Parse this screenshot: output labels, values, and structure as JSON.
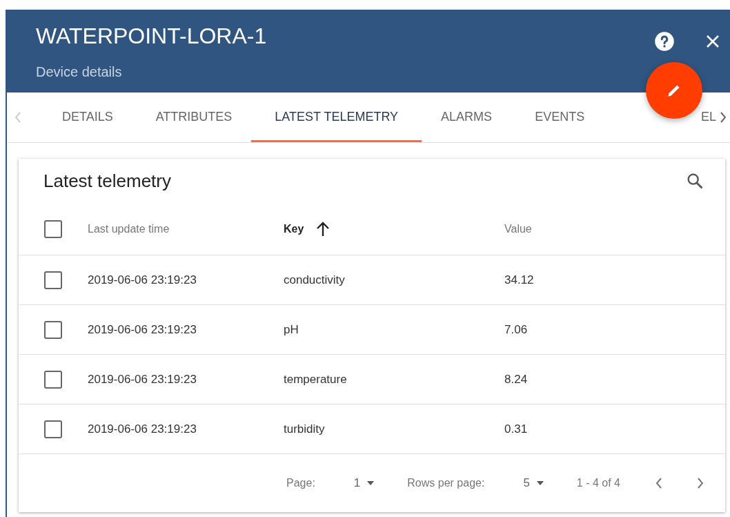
{
  "header": {
    "title": "WATERPOINT-LORA-1",
    "subtitle": "Device details"
  },
  "tabs": [
    {
      "label": "DETAILS",
      "selected": false
    },
    {
      "label": "ATTRIBUTES",
      "selected": false
    },
    {
      "label": "LATEST TELEMETRY",
      "selected": true
    },
    {
      "label": "ALARMS",
      "selected": false
    },
    {
      "label": "EVENTS",
      "selected": false
    },
    {
      "label": "EL",
      "selected": false
    }
  ],
  "card": {
    "title": "Latest telemetry"
  },
  "table": {
    "columns": [
      {
        "label": "Last update time",
        "sorted": false
      },
      {
        "label": "Key",
        "sorted": true
      },
      {
        "label": "Value",
        "sorted": false
      }
    ],
    "select_all": {
      "checked": false
    },
    "rows": [
      {
        "checked": false,
        "time": "2019-06-06 23:19:23",
        "key": "conductivity",
        "value": "34.12"
      },
      {
        "checked": false,
        "time": "2019-06-06 23:19:23",
        "key": "pH",
        "value": "7.06"
      },
      {
        "checked": false,
        "time": "2019-06-06 23:19:23",
        "key": "temperature",
        "value": "8.24"
      },
      {
        "checked": false,
        "time": "2019-06-06 23:19:23",
        "key": "turbidity",
        "value": "0.31"
      }
    ]
  },
  "pagination": {
    "page_label": "Page:",
    "page": "1",
    "rows_label": "Rows per page:",
    "rows_per_page": "5",
    "range": "1 - 4 of 4"
  }
}
